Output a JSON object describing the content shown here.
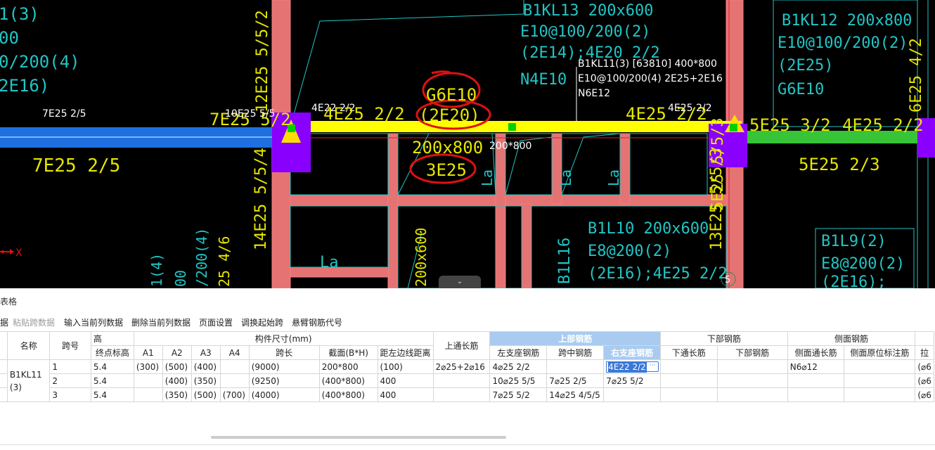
{
  "cad": {
    "labels": {
      "tl1": "1(3)",
      "tl2": "00",
      "tl3": "0/200(4)",
      "tl4": "2E16)",
      "span_left_top": "7E25 2/5",
      "span_left_bot": "7E25 2/5",
      "left_yellow": "7E25 5/2",
      "left_white": "10E25 5/5",
      "col_vert_top": "12E25 5/5/2",
      "col_vert_bot": "14E25 5/5/4",
      "b_4e22_white": "4E22 2/2",
      "b_4e25_yellow": "4E25 2/2",
      "g6e10": "G6E10",
      "e2e20": "(2E20)",
      "sec200": "200x800",
      "e3e25": "3E25",
      "white_section": "200*800",
      "bkl13_1": "B1KL13 200x600",
      "bkl13_2": "E10@100/200(2)",
      "bkl13_3": "(2E14);4E20 2/2",
      "bkl13_4": "N4E10",
      "ann1": "B1KL11(3) [63810] 400*800",
      "ann2": "E10@100/200(4) 2E25+2E16",
      "ann3": "N6E12",
      "right_4e25_yellow": "4E25 2/2",
      "right_4e25_white": "4E25 2/2",
      "bkl12_1": "B1KL12 200x800",
      "bkl12_2": "E10@100/200(2)",
      "bkl12_3": "(2E25)",
      "bkl12_4": "G6E10",
      "r_vert": "6E25 4/2",
      "r_5e25_32": "5E25 3/2",
      "r_4e25_22": "4E25 2/2",
      "r_5e25_23": "5E25 2/3",
      "v_5e25": "5E25 5/5/3",
      "v_13e25": "13E25 5/5/3",
      "b1l10_1": "B1L10 200x600",
      "b1l10_2": "E8@200(2)",
      "b1l10_3": "(2E16);4E25 2/2",
      "b1l9_1": "B1L9(2)",
      "b1l9_2": "E8@200(2)",
      "b1l9_3": "(2E16);",
      "b1l16": "B1L16",
      "v200x600": "200x600",
      "la": "La",
      "axis_x": "X",
      "circle5": "5",
      "bl1": "1(4)",
      "bl2": "00",
      "bl3": "/200(4)",
      "bl4": "25 4/6",
      "c5": "5"
    }
  },
  "panel": {
    "title": "表格",
    "toolbar": {
      "t0": "据",
      "paste_span": "粘贴跨数据",
      "input_col": "输入当前列数据",
      "delete_col": "删除当前列数据",
      "page_setup": "页面设置",
      "swap_start": "调换起始跨",
      "cantilever": "悬臂钢筋代号"
    },
    "headers": {
      "name": "名称",
      "span_no": "跨号",
      "elev": "高",
      "end_elev": "终点标高",
      "dims": "构件尺寸(mm)",
      "a1": "A1",
      "a2": "A2",
      "a3": "A3",
      "a4": "A4",
      "span_len": "跨长",
      "section": "截面(B*H)",
      "edge_dist": "距左边线距离",
      "top_through": "上通长筋",
      "top_rebar": "上部钢筋",
      "left_support": "左支座钢筋",
      "mid_span": "跨中钢筋",
      "right_support": "右支座钢筋",
      "bottom_rebar": "下部钢筋",
      "bottom_through": "下通长筋",
      "bottom_rebar2": "下部钢筋",
      "side_rebar": "侧面钢筋",
      "side_through": "侧面通长筋",
      "side_orig": "侧面原位标注筋",
      "tie": "拉"
    },
    "rows": [
      {
        "name": "B1KL11(3)",
        "span": "1",
        "end_elev": "5.4",
        "a1": "(300)",
        "a2": "(500)",
        "a3": "(400)",
        "a4": "",
        "len": "(9000)",
        "sec": "200*800",
        "edge": "(100)",
        "top_through": "2⌀25+2⌀16",
        "left": "4⌀25 2/2",
        "mid": "",
        "right": "4E22 2/2",
        "bot_through": "",
        "bot": "",
        "side_through": "N6⌀12",
        "side_orig": "",
        "tie": "(⌀6"
      },
      {
        "name": "",
        "span": "2",
        "end_elev": "5.4",
        "a1": "",
        "a2": "(400)",
        "a3": "(350)",
        "a4": "",
        "len": "(9250)",
        "sec": "(400*800)",
        "edge": "400",
        "top_through": "",
        "left": "10⌀25 5/5",
        "mid": "7⌀25 2/5",
        "right": "7⌀25 5/2",
        "bot_through": "",
        "bot": "",
        "side_through": "",
        "side_orig": "",
        "tie": "(⌀6"
      },
      {
        "name": "",
        "span": "3",
        "end_elev": "5.4",
        "a1": "",
        "a2": "(350)",
        "a3": "(500)",
        "a4": "(700)",
        "len": "(4000)",
        "sec": "(400*800)",
        "edge": "400",
        "top_through": "",
        "left": "7⌀25 5/2",
        "mid": "14⌀25 4/5/5",
        "right": "",
        "bot_through": "",
        "bot": "",
        "side_through": "",
        "side_orig": "",
        "tie": "(⌀6"
      }
    ]
  }
}
